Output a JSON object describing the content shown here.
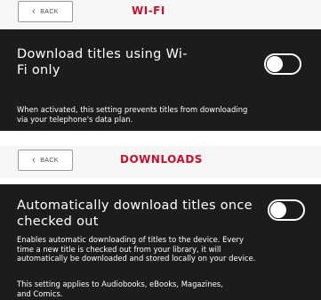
{
  "wifi_section": {
    "back_label": "BACK",
    "header_title": "WI-FI",
    "setting_title_line1": "Download titles using Wi-",
    "setting_title_line2": "Fi only",
    "toggle_on": false,
    "description_line1": "When activated, this setting prevents titles from downloading",
    "description_line2": "via your telephone's data plan."
  },
  "downloads_section": {
    "back_label": "BACK",
    "header_title": "DOWNLOADS",
    "setting_title_line1": "Automatically download titles once",
    "setting_title_line2": "checked out",
    "toggle_on": false,
    "description_lines": [
      "Enables automatic downloading of titles to the device. Every",
      "time a new title is checked out from your library, it will",
      "automatically be downloaded and stored locally on your device."
    ],
    "note_lines": [
      "This setting applies to Audiobooks, eBooks, Magazines,",
      "and Comics."
    ]
  },
  "colors": {
    "accent_red": "#c8102e",
    "panel_bg": "#1c1c1c",
    "header_bg": "#f6f6f6"
  },
  "icons": {
    "back": "chevron-left-icon"
  }
}
